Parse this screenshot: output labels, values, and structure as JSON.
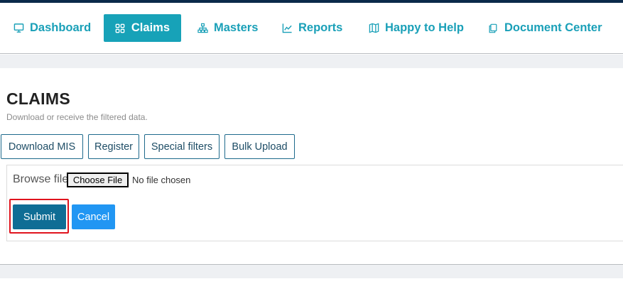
{
  "nav": {
    "items": [
      {
        "label": "Dashboard",
        "icon": "monitor-icon",
        "active": false
      },
      {
        "label": "Claims",
        "icon": "grid-icon",
        "active": true
      },
      {
        "label": "Masters",
        "icon": "sitemap-icon",
        "active": false
      },
      {
        "label": "Reports",
        "icon": "line-chart-icon",
        "active": false
      },
      {
        "label": "Happy to Help",
        "icon": "map-icon",
        "active": false
      },
      {
        "label": "Document Center",
        "icon": "copy-icon",
        "active": false
      }
    ]
  },
  "page": {
    "title": "CLAIMS",
    "subtitle": "Download or receive the filtered data."
  },
  "tabs": [
    "Download MIS",
    "Register",
    "Special filters",
    "Bulk Upload"
  ],
  "upload": {
    "browse_label": "Browse file",
    "choose_button": "Choose File",
    "file_status": "No file chosen",
    "submit_label": "Submit",
    "cancel_label": "Cancel"
  },
  "colors": {
    "accent": "#17a2b8",
    "submit": "#0f6d95",
    "cancel": "#2196f3",
    "highlight": "#e0141e"
  }
}
